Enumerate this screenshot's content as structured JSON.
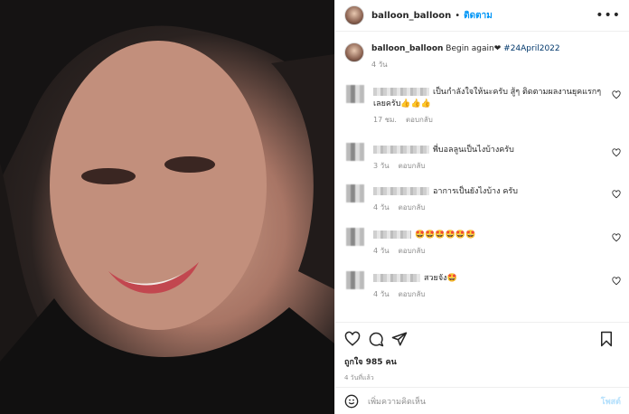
{
  "post": {
    "username": "balloon_balloon",
    "follow_label": "ติดตาม",
    "caption_text": "Begin again❤",
    "caption_hashtag": "#24April2022",
    "caption_time": "4 วัน"
  },
  "comments": [
    {
      "text": "เป็นกำลังใจให้นะครับ สู้ๆ ติดตามผลงานยุคแรกๆ เลยครับ👍👍👍",
      "time": "17 ชม.",
      "reply": "ตอบกลับ"
    },
    {
      "text": "พี่บอลลูนเป็นไงบ้างครับ",
      "time": "3 วัน",
      "reply": "ตอบกลับ"
    },
    {
      "text": "อาการเป็นยังไงบ้าง ครับ",
      "time": "4 วัน",
      "reply": "ตอบกลับ"
    },
    {
      "text": "🤩🤩🤩🤩🤩🤩",
      "time": "4 วัน",
      "reply": "ตอบกลับ"
    },
    {
      "text": "สวยจัง🤩",
      "time": "4 วัน",
      "reply": "ตอบกลับ"
    }
  ],
  "footer": {
    "likes_label": "ถูกใจ 985 คน",
    "date_label": "4 วันที่แล้ว",
    "comment_placeholder": "เพิ่มความคิดเห็น",
    "post_label": "โพสต์"
  },
  "icons": {
    "more": "more-options-icon",
    "like": "heart-icon",
    "comment": "comment-icon",
    "share": "share-icon",
    "save": "bookmark-icon",
    "emoji": "emoji-icon"
  }
}
